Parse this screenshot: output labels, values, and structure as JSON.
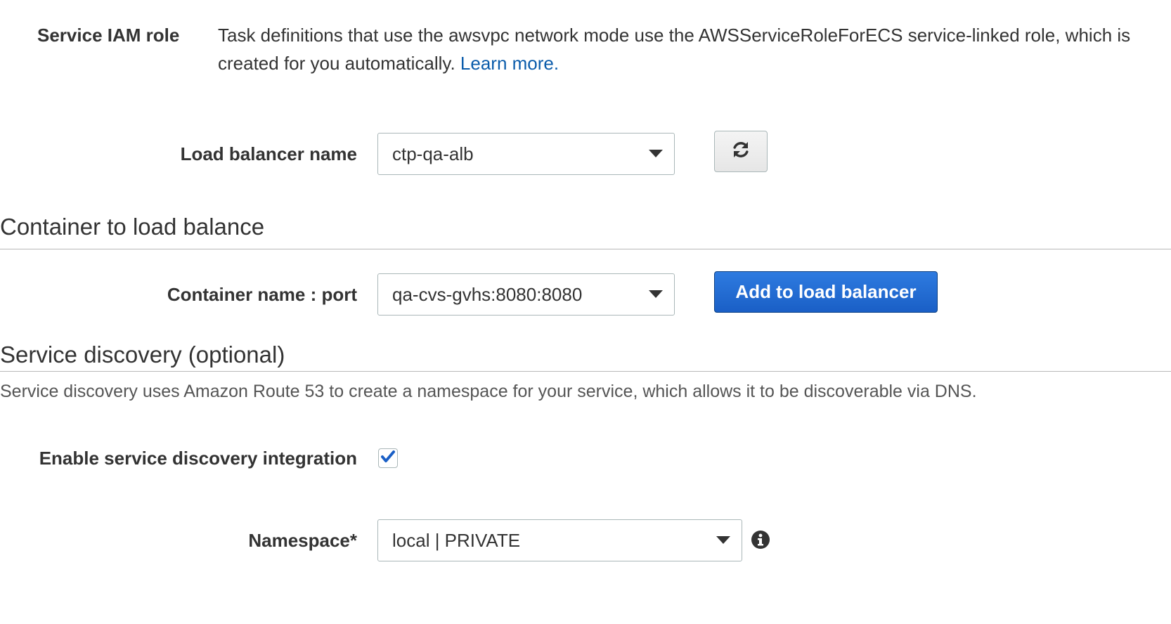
{
  "service_iam": {
    "label": "Service IAM role",
    "description": "Task definitions that use the awsvpc network mode use the AWSServiceRoleForECS service-linked role, which is created for you automatically.",
    "learn_more": "Learn more."
  },
  "load_balancer": {
    "label": "Load balancer name",
    "selected": "ctp-qa-alb",
    "refresh_icon": "refresh-icon"
  },
  "container_section": {
    "title": "Container to load balance",
    "field_label": "Container name : port",
    "selected": "qa-cvs-gvhs:8080:8080",
    "add_button": "Add to load balancer"
  },
  "service_discovery": {
    "title": "Service discovery (optional)",
    "description": "Service discovery uses Amazon Route 53 to create a namespace for your service, which allows it to be discoverable via DNS.",
    "enable_label": "Enable service discovery integration",
    "enabled": true,
    "namespace_label": "Namespace*",
    "namespace_selected": "local | PRIVATE",
    "info_icon": "info-icon"
  },
  "colors": {
    "link": "#0b5cab",
    "primary_button": "#1a5fc6",
    "checkmark": "#1a5fc6"
  }
}
